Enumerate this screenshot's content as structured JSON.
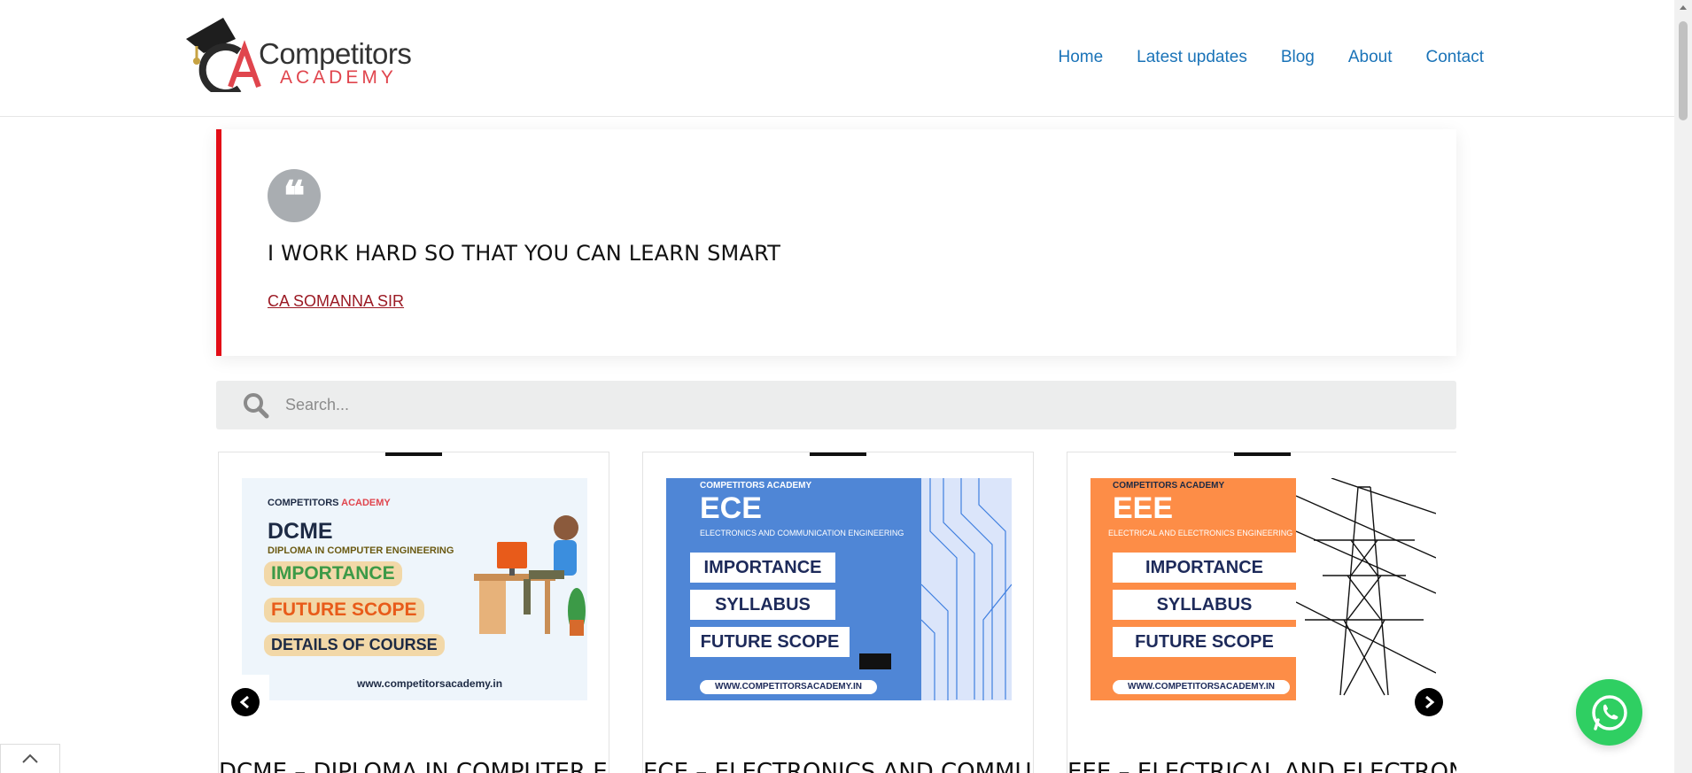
{
  "logo": {
    "line1": "Competitors",
    "line2": "ACADEMY",
    "monogram": "CA"
  },
  "nav": [
    "Home",
    "Latest updates",
    "Blog",
    "About",
    "Contact"
  ],
  "quote": {
    "icon": "quote-icon",
    "text": "I WORK HARD SO THAT YOU CAN LEARN SMART",
    "author": "CA SOMANNA SIR"
  },
  "search": {
    "placeholder": "Search...",
    "icon": "search-icon"
  },
  "posts": [
    {
      "title": "DCME – DIPLOMA IN COMPUTER ENGINEERING",
      "thumb": {
        "brand1": "COMPETITORS",
        "brand2": "ACADEMY",
        "code": "DCME",
        "subtitle": "DIPLOMA IN COMPUTER ENGINEERING",
        "items": [
          "IMPORTANCE",
          "FUTURE SCOPE",
          "DETAILS OF COURSE"
        ],
        "url": "www.competitorsacademy.in"
      }
    },
    {
      "title": "ECE – ELECTRONICS AND COMMUNICATION ENGINEERING",
      "thumb": {
        "brand": "COMPETITORS ACADEMY",
        "code": "ECE",
        "subtitle": "ELECTRONICS AND COMMUNICATION ENGINEERING",
        "items": [
          "IMPORTANCE",
          "SYLLABUS",
          "FUTURE SCOPE"
        ],
        "url": "WWW.COMPETITORSACADEMY.IN"
      }
    },
    {
      "title": "EEE – ELECTRICAL AND ELECTRONICS ENGINEERING",
      "thumb": {
        "brand": "COMPETITORS ACADEMY",
        "code": "EEE",
        "subtitle": "ELECTRICAL AND ELECTRONICS ENGINEERING",
        "items": [
          "IMPORTANCE",
          "SYLLABUS",
          "FUTURE SCOPE"
        ],
        "url": "WWW.COMPETITORSACADEMY.IN"
      }
    }
  ],
  "carousel": {
    "prev_icon": "chevron-left-icon",
    "next_icon": "chevron-right-icon"
  },
  "colors": {
    "accent_red": "#e30d17",
    "link_blue": "#1a73b8",
    "whatsapp_green": "#2fcf62"
  }
}
